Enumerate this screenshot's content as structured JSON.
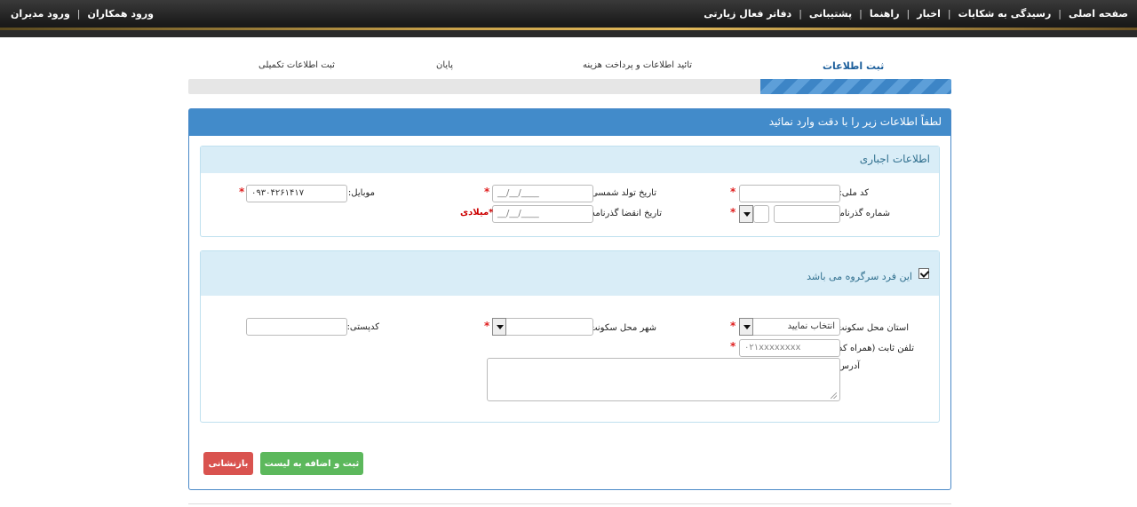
{
  "nav": {
    "right_items": [
      "صفحه اصلی",
      "رسیدگی به شکایات",
      "اخبار",
      "راهنما",
      "پشتیبانی",
      "دفاتر فعال زیارتی"
    ],
    "left_items": [
      "ورود همکاران",
      "ورود مدیران"
    ],
    "separator": "|"
  },
  "steps": {
    "items": [
      "ثبت اطلاعات",
      "تائید اطلاعات و پرداخت هزینه",
      "پایان",
      "ثبت اطلاعات تکمیلی"
    ],
    "progress_percent": 25
  },
  "panel": {
    "title": "لطفاً اطلاعات زیر را با دقت وارد نمائید"
  },
  "mandatory": {
    "title": "اطلاعات اجباری",
    "national_code_label": "کد ملی:",
    "passport_label": "شماره گذرنامه:",
    "birth_date_label": "تاریخ تولد شمسی:",
    "birth_date_value": "__/__/____",
    "passport_expiry_label": "تاریخ انقضا گذرنامه:",
    "passport_expiry_value": "__/__/____",
    "miladi_note": "*میلادی",
    "mobile_label": "موبایل:",
    "mobile_value": "۰۹۳۰۴۲۶۱۴۱۷",
    "required_mark": "*"
  },
  "group": {
    "head_checkbox_label": "این فرد سرگروه می باشد",
    "province_label": "استان محل سکونت:",
    "province_value": "انتخاب نمایید",
    "city_label": "شهر محل سکونت:",
    "postal_label": "کدپستی:",
    "phone_label": "تلفن ثابت (همراه کد):",
    "phone_placeholder": "۰۲۱xxxxxxxx",
    "address_label": "آدرس:"
  },
  "buttons": {
    "submit": "ثبت و اضافه به لیست",
    "reset": "بازنشانی"
  },
  "colors": {
    "primary": "#428bca",
    "success": "#5cb85c",
    "danger": "#d9534f",
    "required": "#e02020",
    "info_bg": "#d9edf7"
  }
}
